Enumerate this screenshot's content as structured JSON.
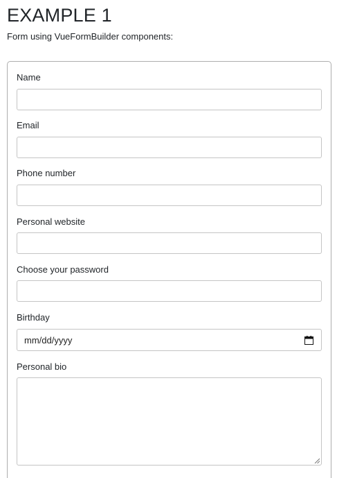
{
  "header": {
    "title": "EXAMPLE 1",
    "subtitle": "Form using VueFormBuilder components:"
  },
  "form": {
    "fields": [
      {
        "label": "Name",
        "type": "text",
        "value": ""
      },
      {
        "label": "Email",
        "type": "email",
        "value": ""
      },
      {
        "label": "Phone number",
        "type": "tel",
        "value": ""
      },
      {
        "label": "Personal website",
        "type": "url",
        "value": ""
      },
      {
        "label": "Choose your password",
        "type": "password",
        "value": ""
      },
      {
        "label": "Birthday",
        "type": "date",
        "placeholder": "mm/dd/yyyy",
        "value": ""
      },
      {
        "label": "Personal bio",
        "type": "textarea",
        "value": ""
      }
    ]
  },
  "icons": {
    "calendar": "calendar-icon",
    "resize": "resize-grip-icon"
  }
}
